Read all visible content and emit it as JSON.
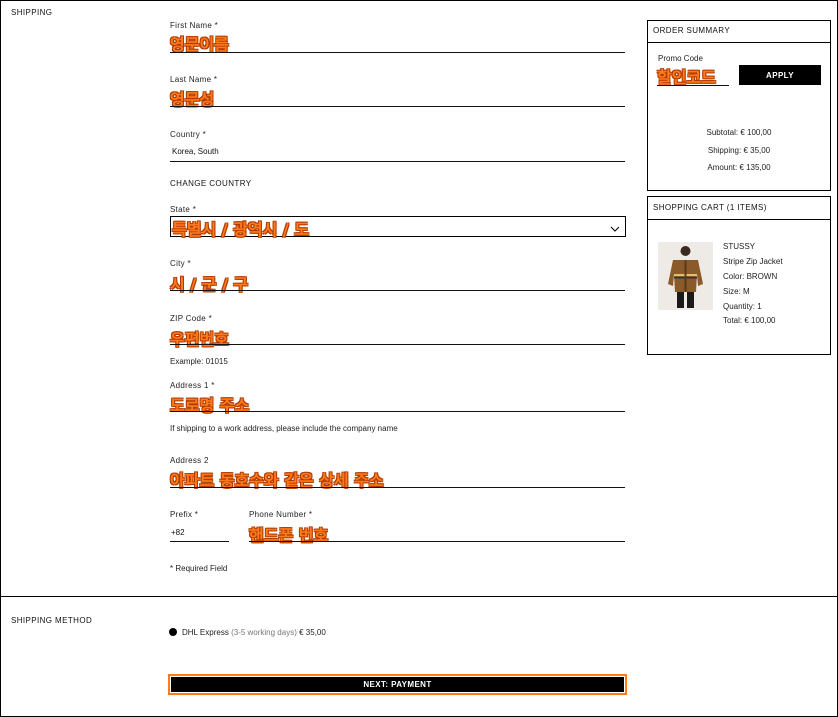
{
  "sections": {
    "shipping_title": "SHIPPING",
    "shipping_method_title": "SHIPPING METHOD"
  },
  "form": {
    "first_name": {
      "label": "First Name *",
      "value": "영문이름"
    },
    "last_name": {
      "label": "Last Name *",
      "value": "영문성"
    },
    "country": {
      "label": "Country *",
      "value": "Korea, South",
      "change": "CHANGE COUNTRY"
    },
    "state": {
      "label": "State *",
      "value": "특별시 / 광역시 / 도"
    },
    "city": {
      "label": "City *",
      "value": "시 / 군 / 구"
    },
    "zip": {
      "label": "ZIP Code *",
      "value": "우편번호",
      "hint": "Example: 01015"
    },
    "address1": {
      "label": "Address 1 *",
      "value": "도로명 주소",
      "hint": "If shipping to a work address, please include the company name"
    },
    "address2": {
      "label": "Address 2",
      "value": "아파트 동호수와 같은 상세 주소"
    },
    "prefix": {
      "label": "Prefix *",
      "value": "+82"
    },
    "phone": {
      "label": "Phone Number *",
      "value": "핸드폰 번호"
    },
    "required_note": "* Required Field"
  },
  "shipping_method": {
    "name": "DHL Express",
    "duration": "(3-5 working days)",
    "price": "€ 35,00"
  },
  "next_button": "NEXT: PAYMENT",
  "order_summary": {
    "title": "ORDER SUMMARY",
    "promo_label": "Promo Code",
    "promo_value": "할인코드",
    "apply": "APPLY",
    "subtotal": "Subtotal: € 100,00",
    "shipping": "Shipping: € 35,00",
    "amount": "Amount: € 135,00"
  },
  "cart": {
    "title": "SHOPPING CART (1 ITEMS)",
    "brand": "STUSSY",
    "product": "Stripe Zip Jacket",
    "color": "Color: BROWN",
    "size": "Size: M",
    "quantity": "Quantity: 1",
    "total": "Total: € 100,00"
  },
  "colors": {
    "accent": "#ff7a1a",
    "button": "#000000"
  }
}
